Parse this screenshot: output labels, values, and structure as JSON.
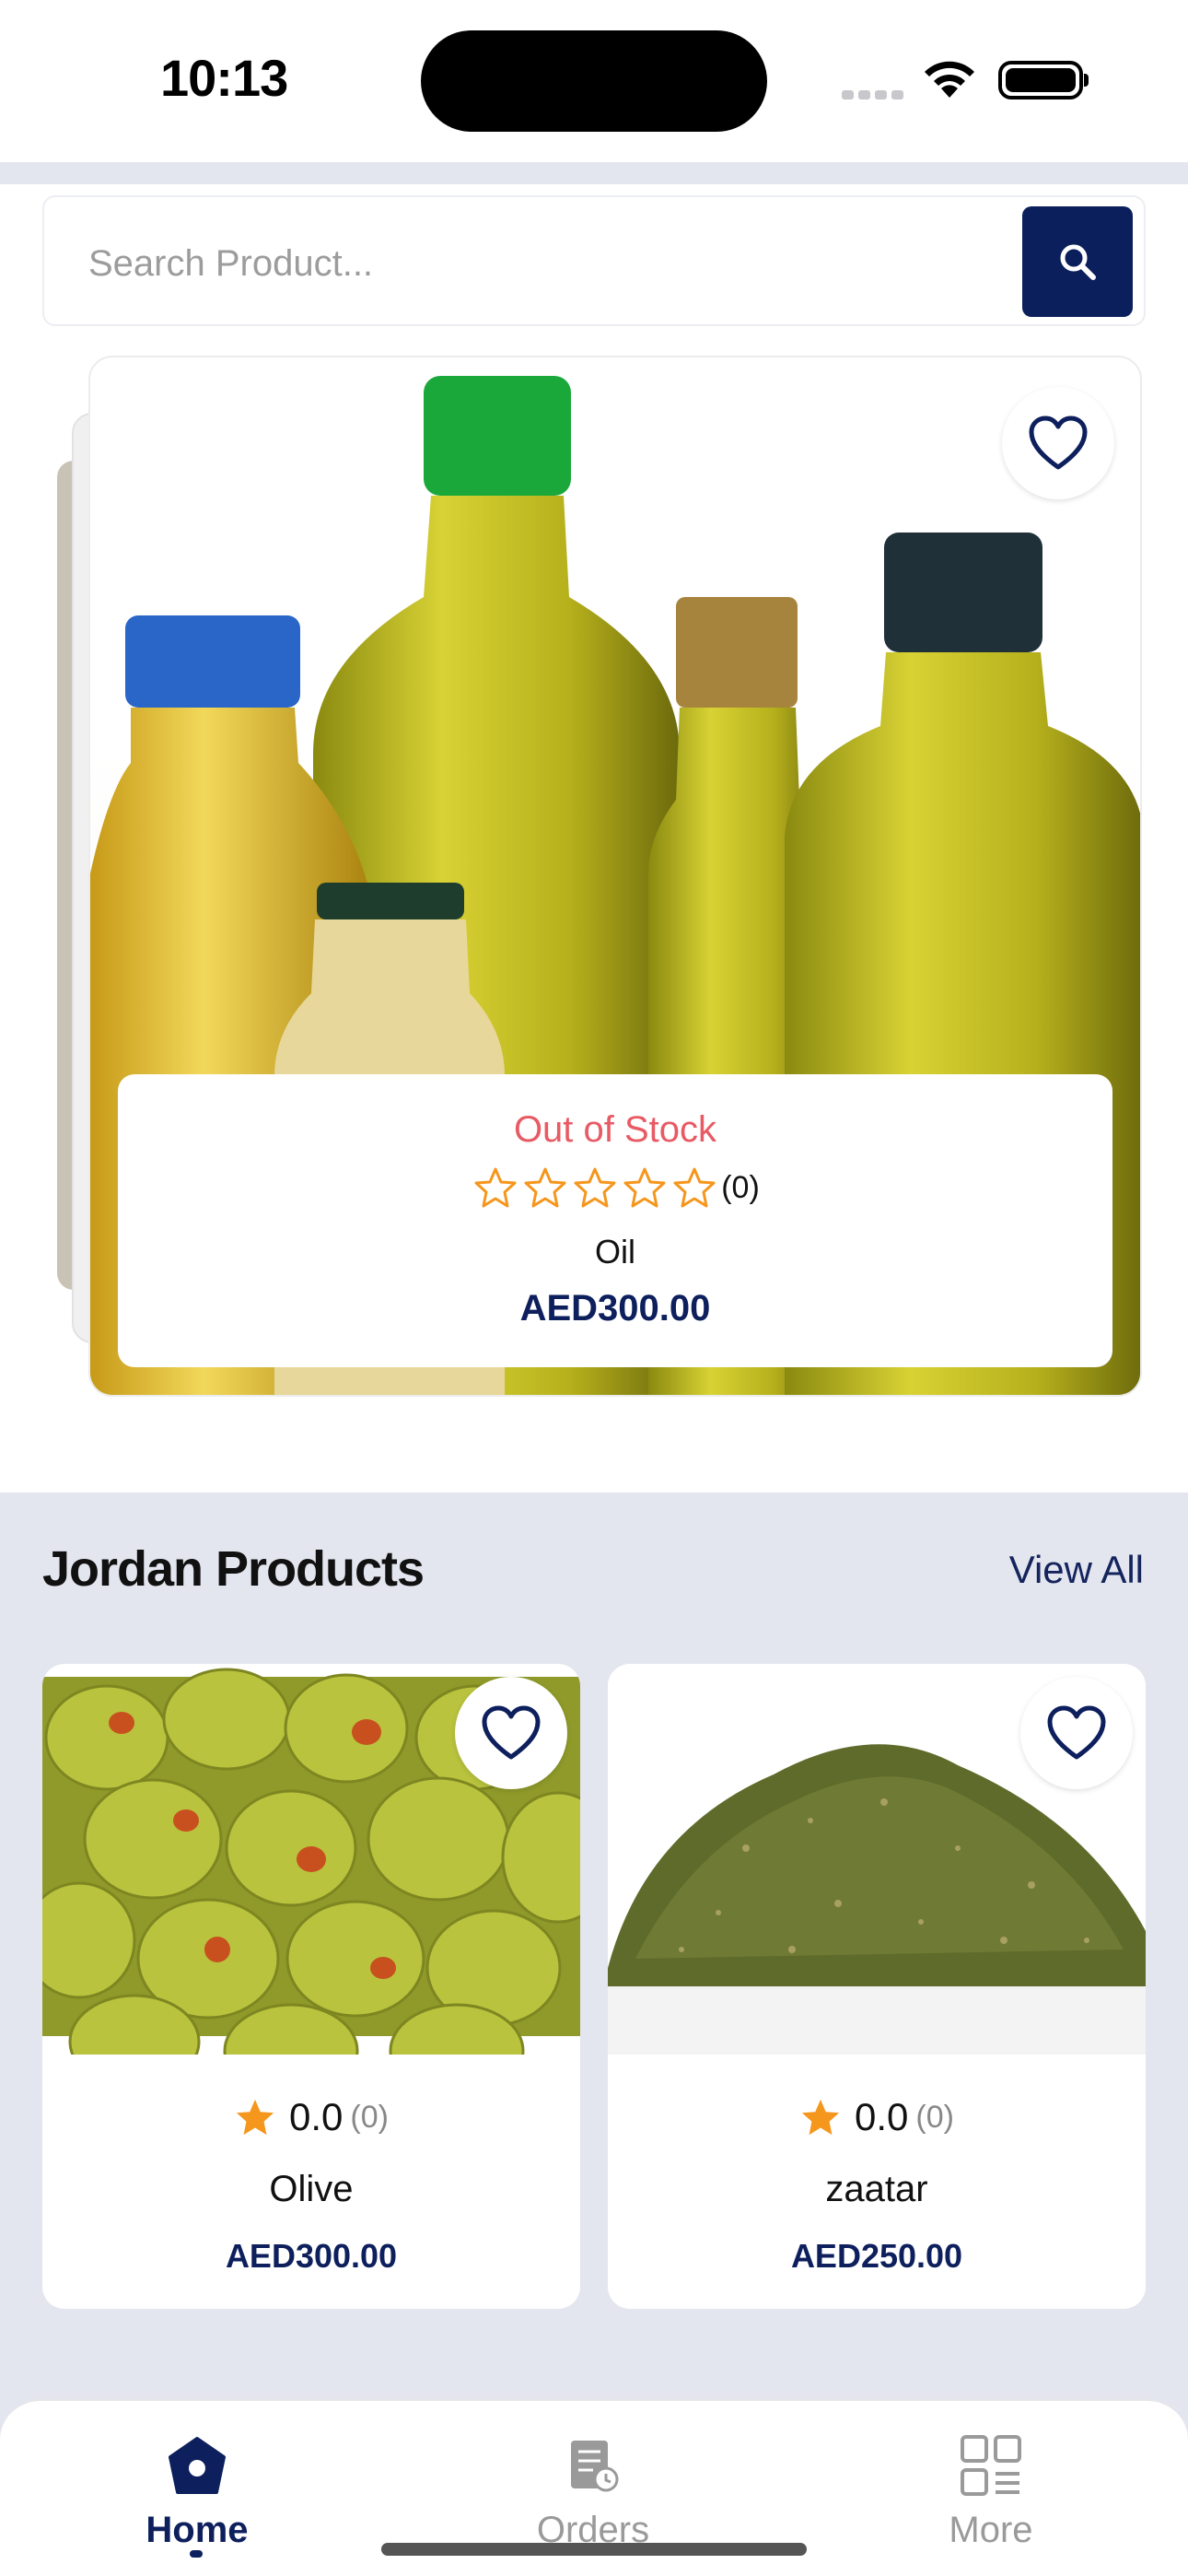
{
  "status_bar": {
    "time": "10:13"
  },
  "search": {
    "placeholder": "Search Product..."
  },
  "featured": {
    "stock_status": "Out of Stock",
    "rating_count": "(0)",
    "stars": 0,
    "name": "Oil",
    "price": "AED300.00"
  },
  "section": {
    "title": "Jordan Products",
    "view_all": "View All",
    "products": [
      {
        "rating": "0.0",
        "rating_count": "(0)",
        "name": "Olive",
        "price": "AED300.00"
      },
      {
        "rating": "0.0",
        "rating_count": "(0)",
        "name": "zaatar",
        "price": "AED250.00"
      }
    ]
  },
  "nav": {
    "items": [
      {
        "label": "Home",
        "icon": "home-icon",
        "active": true
      },
      {
        "label": "Orders",
        "icon": "orders-icon",
        "active": false
      },
      {
        "label": "More",
        "icon": "grid-icon",
        "active": false
      }
    ]
  },
  "colors": {
    "primary": "#0a1f5c",
    "out_of_stock": "#e85a64",
    "star": "#f5961d",
    "section_bg": "#e4e6ef"
  }
}
